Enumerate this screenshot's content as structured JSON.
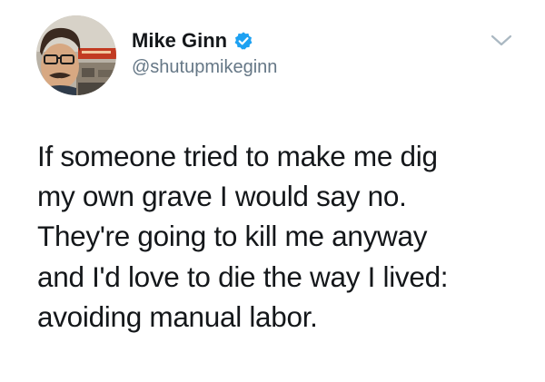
{
  "tweet": {
    "author": {
      "display_name": "Mike Ginn",
      "username": "@shutupmikeginn",
      "verified": true
    },
    "text_lines": [
      "If someone tried to make me dig",
      "my own grave I would say no.",
      "They're going to kill me anyway",
      "and I'd love to die the way I lived:",
      "avoiding manual labor."
    ]
  },
  "colors": {
    "text_primary": "#14171a",
    "text_secondary": "#657786",
    "verified_blue": "#1da1f2",
    "caret": "#aab8c2",
    "background": "#ffffff"
  },
  "icons": {
    "verified": "verified-badge-icon",
    "more": "chevron-down-icon"
  }
}
